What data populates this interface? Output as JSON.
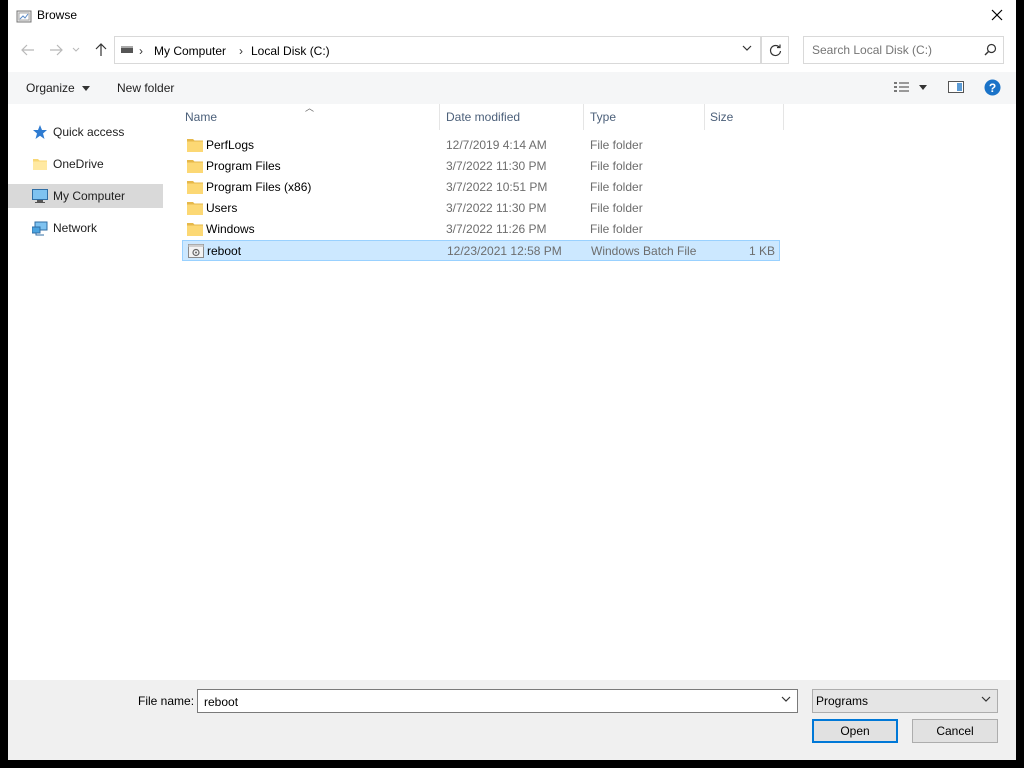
{
  "window": {
    "title": "Browse"
  },
  "address": {
    "crumbs": [
      "My Computer",
      "Local Disk (C:)"
    ]
  },
  "search": {
    "placeholder": "Search Local Disk (C:)"
  },
  "toolbar": {
    "organize": "Organize",
    "new_folder": "New folder"
  },
  "nav": [
    {
      "label": "Quick access",
      "icon": "star-icon"
    },
    {
      "label": "OneDrive",
      "icon": "folder-icon"
    },
    {
      "label": "My Computer",
      "icon": "computer-icon",
      "selected": true
    },
    {
      "label": "Network",
      "icon": "network-icon"
    }
  ],
  "columns": {
    "name": "Name",
    "date": "Date modified",
    "type": "Type",
    "size": "Size"
  },
  "files": [
    {
      "name": "PerfLogs",
      "date": "12/7/2019 4:14 AM",
      "type": "File folder",
      "size": "",
      "icon": "folder-icon"
    },
    {
      "name": "Program Files",
      "date": "3/7/2022 11:30 PM",
      "type": "File folder",
      "size": "",
      "icon": "folder-icon"
    },
    {
      "name": "Program Files (x86)",
      "date": "3/7/2022 10:51 PM",
      "type": "File folder",
      "size": "",
      "icon": "folder-icon"
    },
    {
      "name": "Users",
      "date": "3/7/2022 11:30 PM",
      "type": "File folder",
      "size": "",
      "icon": "folder-icon"
    },
    {
      "name": "Windows",
      "date": "3/7/2022 11:26 PM",
      "type": "File folder",
      "size": "",
      "icon": "folder-icon"
    },
    {
      "name": "reboot",
      "date": "12/23/2021 12:58 PM",
      "type": "Windows Batch File",
      "size": "1 KB",
      "icon": "batch-file-icon",
      "selected": true
    }
  ],
  "bottom": {
    "file_name_label": "File name:",
    "file_name_value": "reboot",
    "file_type": "Programs",
    "open_label": "Open",
    "cancel_label": "Cancel"
  },
  "colors": {
    "selection": "#cce8ff",
    "selection_border": "#99d1ff",
    "accent": "#0078d7",
    "help": "#1a73c8"
  }
}
